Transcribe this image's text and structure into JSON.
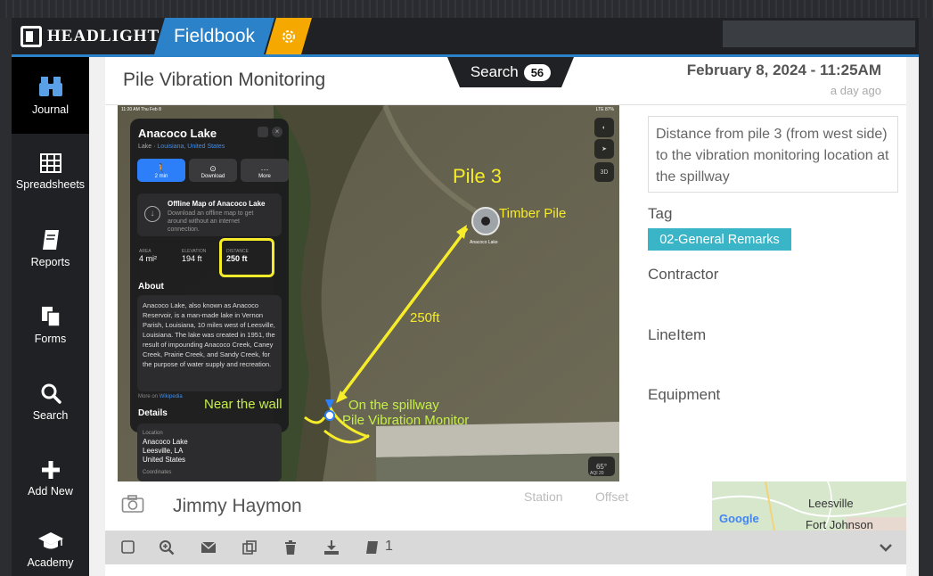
{
  "app": {
    "brand": "HEADLIGHT",
    "product": "Fieldbook"
  },
  "sidebar": {
    "items": [
      {
        "label": "Journal",
        "icon": "binoculars-icon",
        "active": true
      },
      {
        "label": "Spreadsheets",
        "icon": "table-icon"
      },
      {
        "label": "Reports",
        "icon": "notebook-icon"
      },
      {
        "label": "Forms",
        "icon": "forms-icon"
      },
      {
        "label": "Search",
        "icon": "search-icon"
      },
      {
        "label": "Add New",
        "icon": "plus-icon"
      },
      {
        "label": "Academy",
        "icon": "graduation-cap-icon"
      }
    ]
  },
  "entry": {
    "title": "Pile Vibration Monitoring",
    "search_label": "Search",
    "search_count": "56",
    "date": "February 8, 2024 - 11:25AM",
    "relative_time": "a day ago",
    "description": "Distance from pile 3 (from west side) to the vibration monitoring location at the spillway",
    "tag_label": "Tag",
    "tag_value": "02-General Remarks",
    "contractor_label": "Contractor",
    "lineitem_label": "LineItem",
    "equipment_label": "Equipment",
    "author": "Jimmy Haymon",
    "station_label": "Station",
    "offset_label": "Offset",
    "attachment_count": "1"
  },
  "photo": {
    "status_time": "11:20 AM  Thu Feb 8",
    "status_right": "LTE 87%",
    "place_name": "Anacoco Lake",
    "place_type": "Lake · ",
    "place_region": "Louisiana, United States",
    "btn_directions": "2 min",
    "btn_download": "Download",
    "btn_more": "More",
    "offline_title": "Offline Map of Anacoco Lake",
    "offline_desc": "Download an offline map to get around without an internet connection.",
    "area_label": "AREA",
    "area_value": "4 mi²",
    "elevation_label": "ELEVATION",
    "elevation_value": "194 ft",
    "distance_label": "DISTANCE",
    "distance_value": "250 ft",
    "about_heading": "About",
    "about_text": "Anacoco Lake, also known as Anacoco Reservoir, is a man-made lake in Vernon Parish, Louisiana, 10 miles west of Leesville, Louisiana. The lake was created in 1951, the result of impounding Anacoco Creek, Caney Creek, Prairie Creek, and Sandy Creek, for the purpose of water supply and recreation.",
    "more_on": "More on ",
    "more_on_link": "Wikipedia",
    "details_heading": "Details",
    "location_label": "Location",
    "location_lines": [
      "Anacoco Lake",
      "Leesville, LA",
      "United States"
    ],
    "coordinates_label": "Coordinates",
    "annot_pile": "Pile 3",
    "annot_timber": "Timber Pile",
    "annot_distance": "250ft",
    "annot_wall": "Near the wall",
    "annot_spillway": "On the spillway",
    "annot_monitor": "Pile Vibration Monitor",
    "pin_label": "Anacoco Lake",
    "weather": "65°",
    "aqi": "AQI 20",
    "ctrl_3d": "3D"
  },
  "minimap": {
    "city": "Leesville",
    "place": "Fort Johnson",
    "provider": "Google"
  },
  "colors": {
    "brand_blue": "#2b82c9",
    "gear_orange": "#f5a800",
    "tag_teal": "#3ab4c7",
    "annotation_yellow": "#f6ec2a"
  }
}
